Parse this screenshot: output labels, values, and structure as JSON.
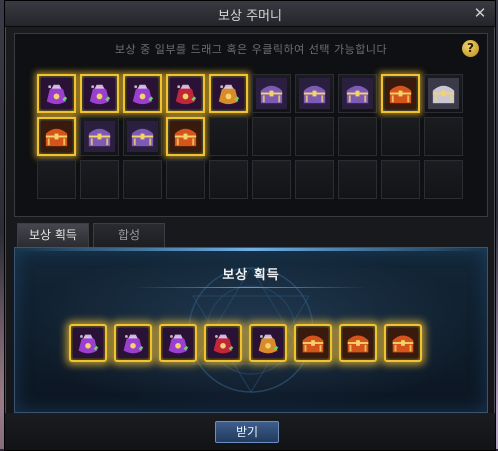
{
  "window": {
    "title": "보상 주머니",
    "close_glyph": "✕"
  },
  "top_panel": {
    "instruction": "보상 중 일부를 드래그 혹은 우클릭하여 선택 가능합니다",
    "help_glyph": "?",
    "slots": [
      {
        "kind": "purple-pouch",
        "selected": true
      },
      {
        "kind": "purple-pouch",
        "selected": true
      },
      {
        "kind": "purple-pouch",
        "selected": true
      },
      {
        "kind": "red-pouch",
        "selected": true
      },
      {
        "kind": "orange-pouch",
        "selected": true
      },
      {
        "kind": "purple-chest",
        "selected": false
      },
      {
        "kind": "purple-chest",
        "selected": false
      },
      {
        "kind": "purple-chest",
        "selected": false
      },
      {
        "kind": "orange-chest",
        "selected": true
      },
      {
        "kind": "silver-chest",
        "selected": false
      },
      {
        "kind": "orange-chest",
        "selected": true
      },
      {
        "kind": "purple-chest",
        "selected": false
      },
      {
        "kind": "purple-chest",
        "selected": false
      },
      {
        "kind": "orange-chest",
        "selected": true
      },
      {
        "kind": "empty",
        "selected": false
      },
      {
        "kind": "empty",
        "selected": false
      },
      {
        "kind": "empty",
        "selected": false
      },
      {
        "kind": "empty",
        "selected": false
      },
      {
        "kind": "empty",
        "selected": false
      },
      {
        "kind": "empty",
        "selected": false
      },
      {
        "kind": "empty",
        "selected": false
      },
      {
        "kind": "empty",
        "selected": false
      },
      {
        "kind": "empty",
        "selected": false
      },
      {
        "kind": "empty",
        "selected": false
      },
      {
        "kind": "empty",
        "selected": false
      },
      {
        "kind": "empty",
        "selected": false
      },
      {
        "kind": "empty",
        "selected": false
      },
      {
        "kind": "empty",
        "selected": false
      },
      {
        "kind": "empty",
        "selected": false
      },
      {
        "kind": "empty",
        "selected": false
      }
    ]
  },
  "tabs": [
    {
      "label": "보상 획득",
      "active": true
    },
    {
      "label": "합성",
      "active": false
    }
  ],
  "acquisition": {
    "title": "보상 획득",
    "items": [
      {
        "kind": "purple-pouch"
      },
      {
        "kind": "purple-pouch"
      },
      {
        "kind": "purple-pouch"
      },
      {
        "kind": "red-pouch"
      },
      {
        "kind": "orange-pouch"
      },
      {
        "kind": "orange-chest"
      },
      {
        "kind": "orange-chest"
      },
      {
        "kind": "orange-chest"
      }
    ]
  },
  "footer": {
    "confirm_label": "받기"
  },
  "colors": {
    "selection_gold": "#f2c230",
    "panel_blue": "#13283a",
    "pouch_purple": "#9b3fd1",
    "pouch_red": "#c2263a",
    "pouch_orange": "#d98a2a",
    "chest_orange": "#d4541c",
    "chest_purple": "#7d5ab6",
    "chest_silver": "#c9c6d6"
  }
}
